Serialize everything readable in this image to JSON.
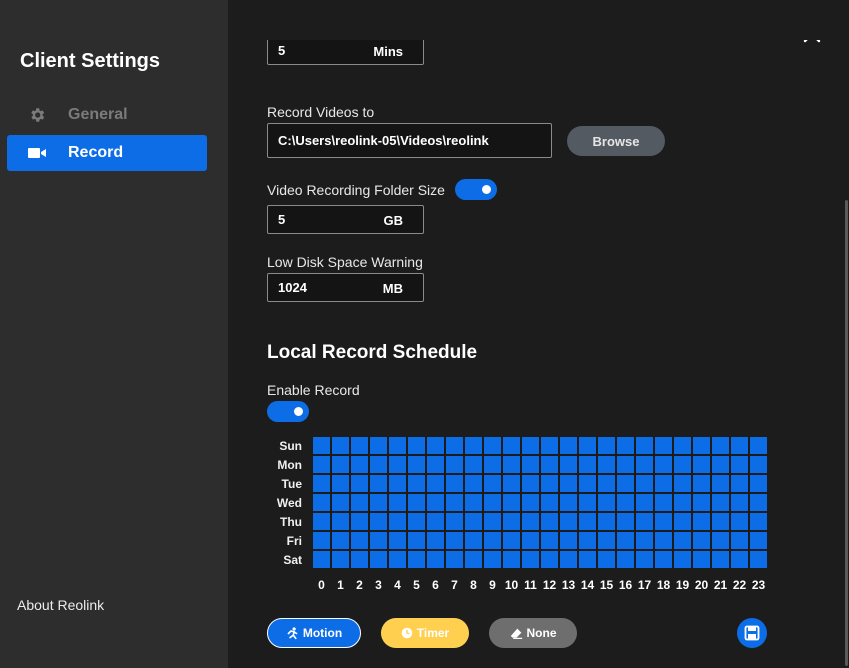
{
  "sidebar": {
    "title": "Client Settings",
    "items": [
      {
        "label": "General",
        "icon": "gear-icon",
        "active": false
      },
      {
        "label": "Record",
        "icon": "video-camera-icon",
        "active": true
      }
    ],
    "about": "About Reolink"
  },
  "record": {
    "top_field": {
      "value": "5",
      "unit": "Mins"
    },
    "record_to_label": "Record Videos to",
    "record_path": "C:\\Users\\reolink-05\\Videos\\reolink",
    "browse_label": "Browse",
    "folder_size_label": "Video Recording Folder Size",
    "folder_size_enabled": true,
    "folder_size": {
      "value": "5",
      "unit": "GB"
    },
    "low_disk_label": "Low Disk Space Warning",
    "low_disk": {
      "value": "1024",
      "unit": "MB"
    }
  },
  "schedule": {
    "title": "Local Record Schedule",
    "enable_label": "Enable Record",
    "enabled": true,
    "days": [
      "Sun",
      "Mon",
      "Tue",
      "Wed",
      "Thu",
      "Fri",
      "Sat"
    ],
    "hours": [
      "0",
      "1",
      "2",
      "3",
      "4",
      "5",
      "6",
      "7",
      "8",
      "9",
      "10",
      "11",
      "12",
      "13",
      "14",
      "15",
      "16",
      "17",
      "18",
      "19",
      "20",
      "21",
      "22",
      "23"
    ],
    "cell_state": "Motion",
    "cell_color": "#0d6de6"
  },
  "legend": {
    "motion": "Motion",
    "timer": "Timer",
    "none": "None"
  },
  "colors": {
    "accent": "#0d6de6",
    "timer": "#ffd04f",
    "none": "#6e6e6e"
  }
}
